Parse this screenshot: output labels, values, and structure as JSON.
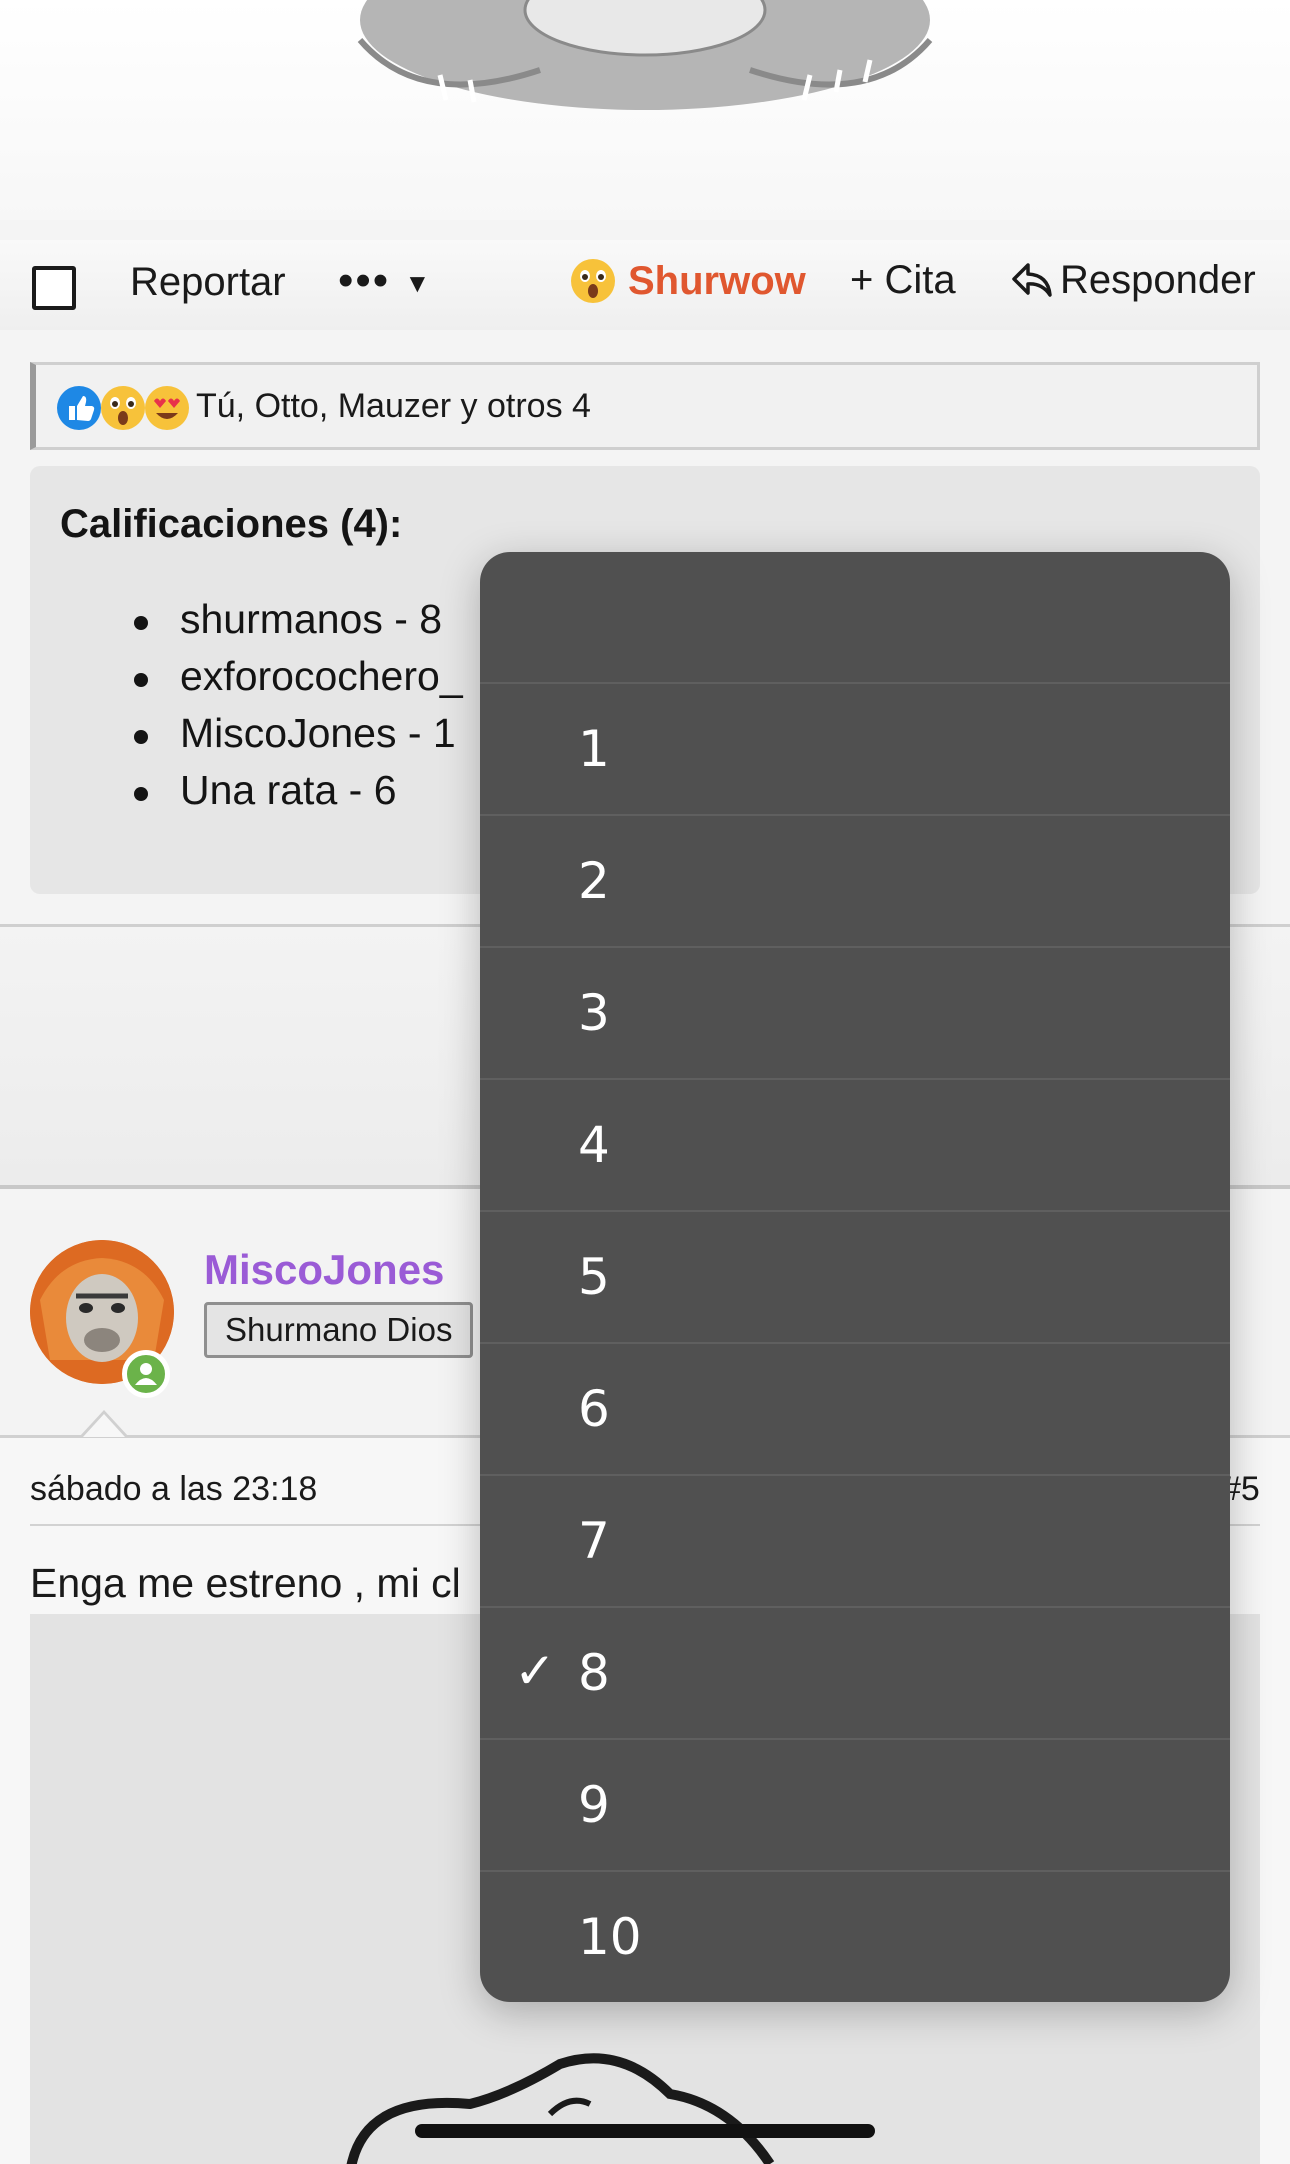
{
  "action_bar": {
    "report_label": "Reportar",
    "more_label": "•••",
    "shurwow_label": "Shurwow",
    "quote_label": "+ Cita",
    "reply_label": "Responder"
  },
  "reactions": {
    "text": "Tú, Otto, Mauzer y otros 4",
    "icons": [
      "thumbs-up-icon",
      "astonished-face-icon",
      "heart-eyes-icon"
    ]
  },
  "ratings": {
    "title": "Calificaciones (4):",
    "items": [
      "shurmanos - 8",
      "exforocochero_",
      "MiscoJones - 1",
      "Una rata - 6"
    ]
  },
  "post": {
    "username": "MiscoJones",
    "rank": "Shurmano Dios",
    "date": "sábado a las 23:18",
    "number": "#5",
    "text": "Enga me estreno , mi cl"
  },
  "picker": {
    "options": [
      "",
      "1",
      "2",
      "3",
      "4",
      "5",
      "6",
      "7",
      "8",
      "9",
      "10"
    ],
    "selected": "8",
    "check_mark": "✓"
  },
  "colors": {
    "shurwow": "#e0572f",
    "username": "#9a5bd6",
    "picker_bg": "#505050",
    "online": "#6bb34a"
  }
}
